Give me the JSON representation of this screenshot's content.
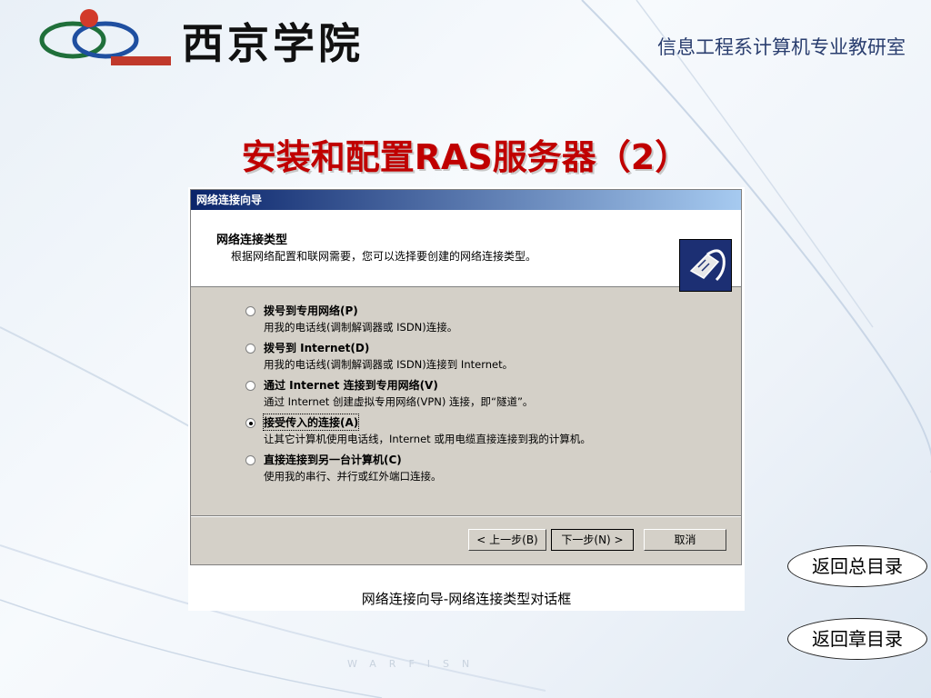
{
  "header": {
    "school_name": "西京学院",
    "department": "信息工程系计算机专业教研室"
  },
  "slide": {
    "title": "安装和配置RAS服务器（2）"
  },
  "dialog": {
    "window_title": "网络连接向导",
    "header_title": "网络连接类型",
    "header_desc": "根据网络配置和联网需要，您可以选择要创建的网络连接类型。",
    "options": [
      {
        "label": "拨号到专用网络(P)",
        "desc": "用我的电话线(调制解调器或 ISDN)连接。",
        "selected": false
      },
      {
        "label": "拨号到 Internet(D)",
        "desc": "用我的电话线(调制解调器或 ISDN)连接到 Internet。",
        "selected": false
      },
      {
        "label": "通过 Internet 连接到专用网络(V)",
        "desc": "通过 Internet 创建虚拟专用网络(VPN) 连接，即“隧道”。",
        "selected": false
      },
      {
        "label": "接受传入的连接(A)",
        "desc": "让其它计算机使用电话线，Internet 或用电缆直接连接到我的计算机。",
        "selected": true
      },
      {
        "label": "直接连接到另一台计算机(C)",
        "desc": "使用我的串行、并行或红外端口连接。",
        "selected": false
      }
    ],
    "buttons": {
      "back": "< 上一步(B)",
      "next": "下一步(N) >",
      "cancel": "取消"
    }
  },
  "caption": "网络连接向导-网络连接类型对话框",
  "nav": {
    "back_to_toc": "返回总目录",
    "back_to_chapter": "返回章目录"
  },
  "watermark": "WARFISN",
  "colors": {
    "title": "#c00000",
    "dialog_face": "#d4d0c8",
    "titlebar": "#0a246a"
  }
}
